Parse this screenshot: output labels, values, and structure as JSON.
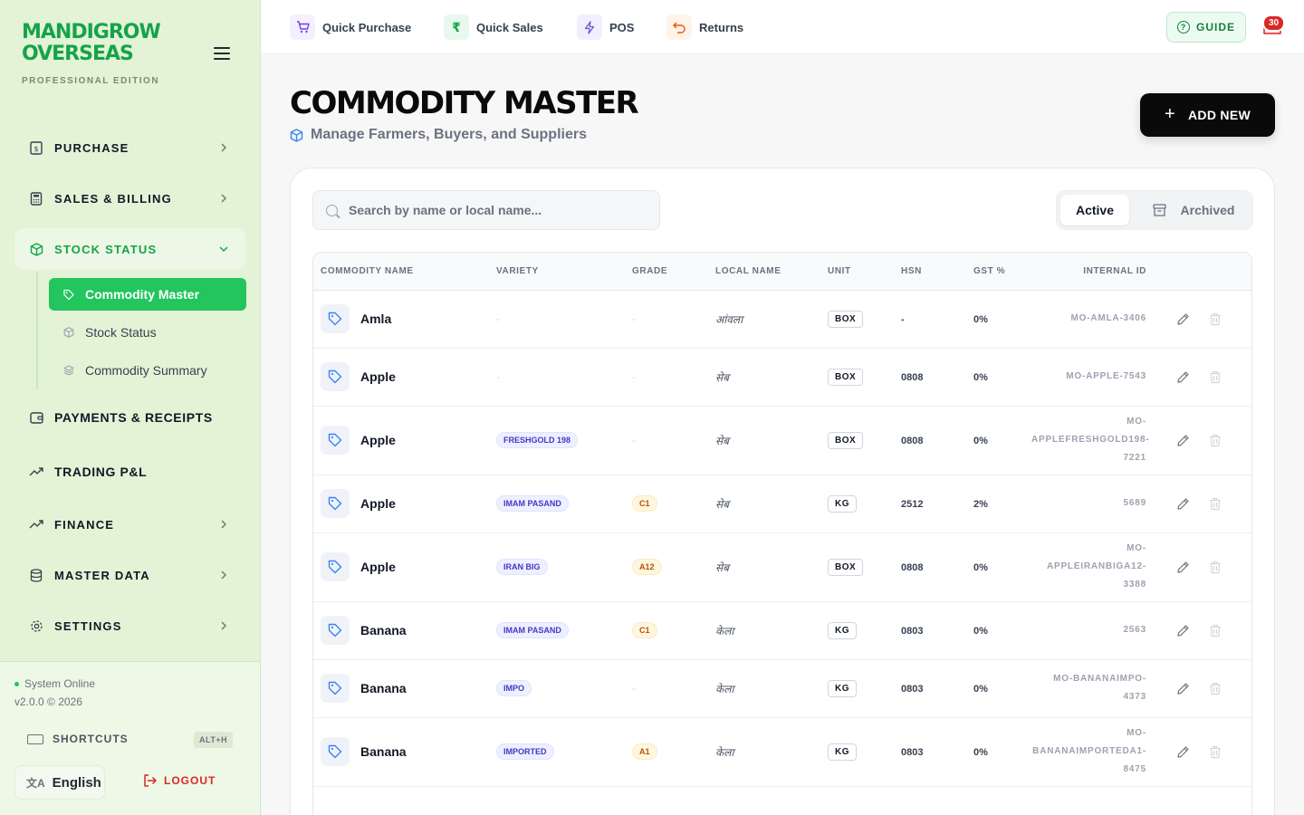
{
  "brand": {
    "line1": "MANDIGROW",
    "line2": "OVERSEAS",
    "edition": "PROFESSIONAL EDITION"
  },
  "nav": {
    "purchase": "PURCHASE",
    "sales": "SALES & BILLING",
    "stock": "STOCK STATUS",
    "payments": "PAYMENTS & RECEIPTS",
    "trading": "TRADING P&L",
    "finance": "FINANCE",
    "master": "MASTER DATA",
    "settings": "SETTINGS"
  },
  "subnav": {
    "commodity_master": "Commodity Master",
    "stock_status": "Stock Status",
    "commodity_summary": "Commodity Summary"
  },
  "footer": {
    "status": "System Online",
    "version": "v2.0.0 © 2026",
    "shortcuts": "SHORTCUTS",
    "shortcut_key": "ALT+H",
    "language": "English",
    "logout": "LOGOUT"
  },
  "topbar": {
    "quick_purchase": "Quick Purchase",
    "quick_sales": "Quick Sales",
    "pos": "POS",
    "returns": "Returns",
    "guide": "GUIDE",
    "notifications": "30",
    "rupee": "₹"
  },
  "page": {
    "title": "COMMODITY MASTER",
    "subtitle": "Manage Farmers, Buyers, and Suppliers",
    "add_new": "ADD NEW",
    "search_placeholder": "Search by name or local name...",
    "filter_active": "Active",
    "filter_archived": "Archived"
  },
  "colors": {
    "brand_green": "#16a34a",
    "active_green": "#22c55e",
    "sidebar_bg": "#e3f3d6",
    "danger": "#dc2626"
  },
  "table": {
    "headers": [
      "COMMODITY NAME",
      "VARIETY",
      "GRADE",
      "LOCAL NAME",
      "UNIT",
      "HSN",
      "GST %",
      "INTERNAL ID"
    ],
    "rows": [
      {
        "name": "Amla",
        "variety": "-",
        "grade": "-",
        "local": "आंवला",
        "unit": "BOX",
        "hsn": "-",
        "gst": "0%",
        "id": [
          "MO-AMLA-3406"
        ]
      },
      {
        "name": "Apple",
        "variety": "-",
        "grade": "-",
        "local": "सेब",
        "unit": "BOX",
        "hsn": "0808",
        "gst": "0%",
        "id": [
          "MO-APPLE-7543"
        ]
      },
      {
        "name": "Apple",
        "variety": "FRESHGOLD 198",
        "grade": "-",
        "local": "सेब",
        "unit": "BOX",
        "hsn": "0808",
        "gst": "0%",
        "id": [
          "MO-",
          "APPLEFRESHGOLD198-",
          "7221"
        ]
      },
      {
        "name": "Apple",
        "variety": "IMAM PASAND",
        "grade": "C1",
        "local": "सेब",
        "unit": "KG",
        "hsn": "2512",
        "gst": "2%",
        "id": [
          "5689"
        ]
      },
      {
        "name": "Apple",
        "variety": "IRAN BIG",
        "grade": "A12",
        "local": "सेब",
        "unit": "BOX",
        "hsn": "0808",
        "gst": "0%",
        "id": [
          "MO-",
          "APPLEIRANBIGA12-",
          "3388"
        ]
      },
      {
        "name": "Banana",
        "variety": "IMAM PASAND",
        "grade": "C1",
        "local": "केला",
        "unit": "KG",
        "hsn": "0803",
        "gst": "0%",
        "id": [
          "2563"
        ]
      },
      {
        "name": "Banana",
        "variety": "IMPO",
        "grade": "-",
        "local": "केला",
        "unit": "KG",
        "hsn": "0803",
        "gst": "0%",
        "id": [
          "MO-BANANAIMPO-",
          "4373"
        ]
      },
      {
        "name": "Banana",
        "variety": "IMPORTED",
        "grade": "A1",
        "local": "केला",
        "unit": "KG",
        "hsn": "0803",
        "gst": "0%",
        "id": [
          "MO-",
          "BANANAIMPORTEDA1-",
          "8475"
        ]
      }
    ]
  },
  "icons": {
    "tag": "tag-icon",
    "edit": "pencil-icon",
    "delete": "trash-icon"
  }
}
